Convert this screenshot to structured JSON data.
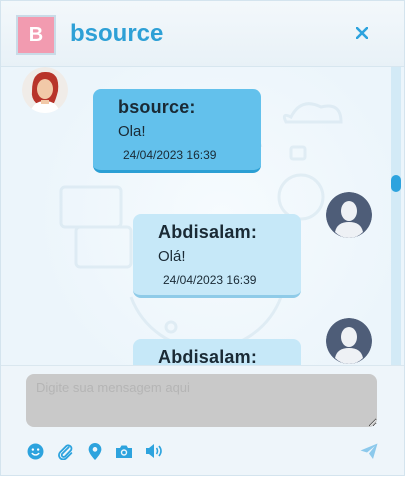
{
  "header": {
    "avatar_letter": "B",
    "title": "bsource",
    "close_icon": "close-icon"
  },
  "messages": [
    {
      "side": "left",
      "sender": "bsource:",
      "text": "Ola!",
      "time": "24/04/2023 16:39",
      "avatar": "agent-avatar-photo"
    },
    {
      "side": "right",
      "sender": "Abdisalam:",
      "text": "Olá!",
      "time": "24/04/2023 16:39",
      "avatar": "user-avatar-icon"
    },
    {
      "side": "right",
      "sender": "Abdisalam:",
      "text": "",
      "time": "",
      "avatar": "user-avatar-icon"
    }
  ],
  "composer": {
    "placeholder": "Digite sua mensagem aqui",
    "tools": [
      "emoji-icon",
      "attach-icon",
      "location-icon",
      "camera-icon",
      "audio-icon"
    ],
    "send_icon": "send-icon"
  },
  "colors": {
    "accent": "#2ea0d6",
    "sent_bubble": "#63c1ec",
    "recv_bubble": "#c6e8f8",
    "icon": "#2da3de"
  }
}
